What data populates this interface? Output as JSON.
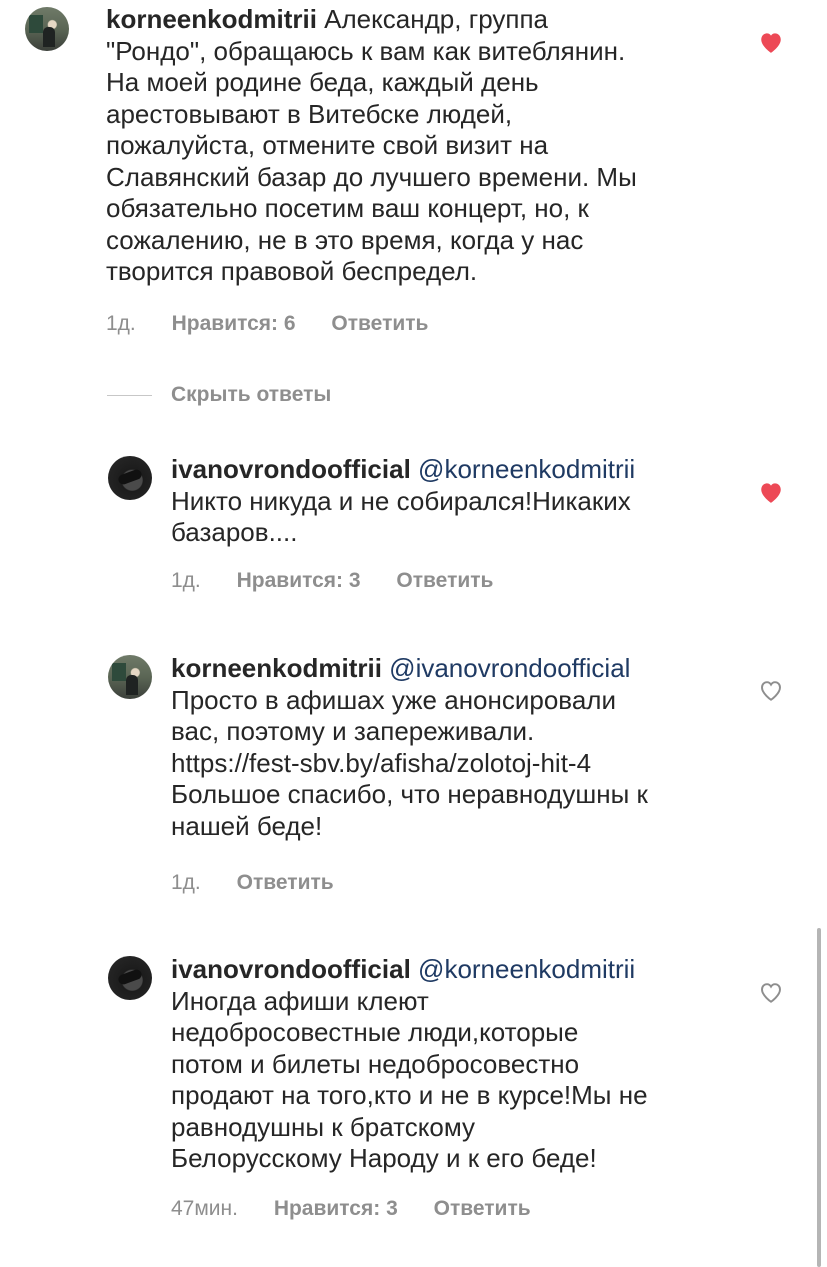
{
  "colors": {
    "text": "#262626",
    "meta": "#8e8e8e",
    "mention": "#1f3a63",
    "liked": "#ed4956"
  },
  "comments": [
    {
      "username": "korneenkodmitrii",
      "lines": [
        "Александр, группа",
        "\"Рондо\", обращаюсь к вам как витеблянин.",
        "На моей родине беда, каждый день",
        "арестовывают в Витебске людей,",
        "пожалуйста, отмените свой визит на",
        "Славянский базар до лучшего времени. Мы",
        "обязательно посетим ваш концерт, но, к",
        "сожалению, не в это время, когда у нас",
        "творится правовой беспредел."
      ],
      "time": "1д.",
      "likes": "Нравится: 6",
      "reply": "Ответить",
      "liked": true,
      "like_icon": "heart-filled-icon"
    }
  ],
  "hide_replies": "Скрыть ответы",
  "replies": [
    {
      "username": "ivanovrondoofficial",
      "mention": "@korneenkodmitrii",
      "lines": [
        "Никто никуда и не собирался!Никаких",
        "базаров...."
      ],
      "time": "1д.",
      "likes": "Нравится: 3",
      "reply": "Ответить",
      "liked": true,
      "like_icon": "heart-filled-icon"
    },
    {
      "username": "korneenkodmitrii",
      "mention": "@ivanovrondoofficial",
      "lines": [
        "Просто в афишах уже анонсировали",
        "вас, поэтому и запереживали.",
        "https://fest-sbv.by/afisha/zolotoj-hit-4",
        "Большое спасибо, что неравнодушны к",
        "нашей беде!"
      ],
      "time": "1д.",
      "reply": "Ответить",
      "liked": false,
      "like_icon": "heart-outline-icon"
    },
    {
      "username": "ivanovrondoofficial",
      "mention": "@korneenkodmitrii",
      "lines": [
        "Иногда афиши клеют",
        "недобросовестные люди,которые",
        "потом и билеты недобросовестно",
        "продают на того,кто и не в курсе!Мы не",
        "равнодушны к братскому",
        "Белорусскому Народу и к его беде!"
      ],
      "time": "47мин.",
      "likes": "Нравится: 3",
      "reply": "Ответить",
      "liked": false,
      "like_icon": "heart-outline-icon"
    }
  ]
}
